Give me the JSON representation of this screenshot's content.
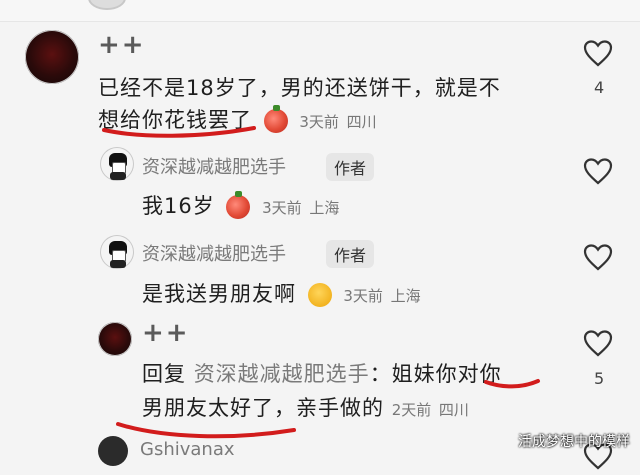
{
  "comments": [
    {
      "name": "++",
      "text_part1": "已经不是18岁了，男的还送饼干，就是不",
      "text_part2": "想给你花钱罢了",
      "time": "3天前",
      "location": "四川",
      "likes": "4"
    },
    {
      "name": "资深越减越肥选手",
      "badge": "作者",
      "text": "我16岁",
      "time": "3天前",
      "location": "上海"
    },
    {
      "name": "资深越减越肥选手",
      "badge": "作者",
      "text": "是我送男朋友啊",
      "time": "3天前",
      "location": "上海"
    },
    {
      "name": "++",
      "reply_prefix": "回复",
      "reply_to": "资深越减越肥选手",
      "text_part1": "：姐妹你对你",
      "text_part2": "男朋友太好了，亲手做的",
      "time": "2天前",
      "location": "四川",
      "likes": "5"
    },
    {
      "name": "Gshivanax"
    }
  ],
  "watermark": "活成梦想中的模样",
  "colors": {
    "underline": "#d21c1c",
    "background": "#f4f4f4"
  },
  "icons": [
    "heart-icon",
    "heart-icon",
    "heart-icon",
    "heart-icon",
    "heart-icon"
  ]
}
